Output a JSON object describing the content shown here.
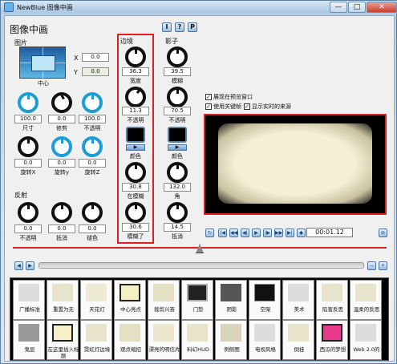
{
  "window": {
    "title": "NewBlue 图像中画",
    "close": "✕",
    "maximize": "□",
    "minimize": "—"
  },
  "header": {
    "title": "图像中画",
    "btn_i": "I",
    "btn_q": "?",
    "btn_p": "P"
  },
  "picture": {
    "section": "图片",
    "x_label": "X",
    "x_value": "0.0",
    "y_label": "Y",
    "y_value": "0.0",
    "picker_label": "中心",
    "knobs": [
      {
        "value": "100.0",
        "label": "尺寸"
      },
      {
        "value": "0.0",
        "label": "修剪"
      },
      {
        "value": "100.0",
        "label": "不透明"
      },
      {
        "value": "0.0",
        "label": "旋转X"
      },
      {
        "value": "0.0",
        "label": "旋转y"
      },
      {
        "value": "0.0",
        "label": "旋转Z"
      }
    ]
  },
  "reflection": {
    "section": "反射",
    "knobs": [
      {
        "value": "0.0",
        "label": "不透明"
      },
      {
        "value": "0.0",
        "label": "抵消"
      },
      {
        "value": "0.0",
        "label": "褪色"
      }
    ]
  },
  "border": {
    "section": "边境",
    "knobs": [
      {
        "value": "36.3",
        "label": "宽度"
      },
      {
        "value": "11.3",
        "label": "不透明"
      },
      {
        "value": "30.8",
        "label": "在模糊"
      },
      {
        "value": "30.6",
        "label": "模糊了"
      }
    ],
    "color_label": "颜色"
  },
  "shadow": {
    "section": "影子",
    "knobs": [
      {
        "value": "39.5",
        "label": "模糊"
      },
      {
        "value": "70.5",
        "label": "不透明"
      },
      {
        "value": "132.0",
        "label": "角"
      },
      {
        "value": "14.5",
        "label": "抵消"
      }
    ],
    "color_label": "颜色"
  },
  "options": [
    {
      "label": "展现在预览窗口",
      "checked": true
    },
    {
      "label": "使用关键帧",
      "checked": true
    },
    {
      "label": "显示实时的来源",
      "checked": true
    }
  ],
  "preview": {
    "timecode": "00:01.12"
  },
  "presets_row1": [
    "广播标准",
    "重置为无",
    "天花灯",
    "中心亮点",
    "裁剪兴奋",
    "门垫",
    "阴影",
    "空架",
    "美术",
    "陷害反思",
    "温柔的反思"
  ],
  "presets_row2": [
    "鬼层",
    "在这里插入标题",
    "霓虹灯边境",
    "观点缩招",
    "漂亮的明信片",
    "料幻HUD",
    "例侧图",
    "电视风格",
    "倒挂",
    "西瓜的梦想",
    "Web 2.0的"
  ]
}
